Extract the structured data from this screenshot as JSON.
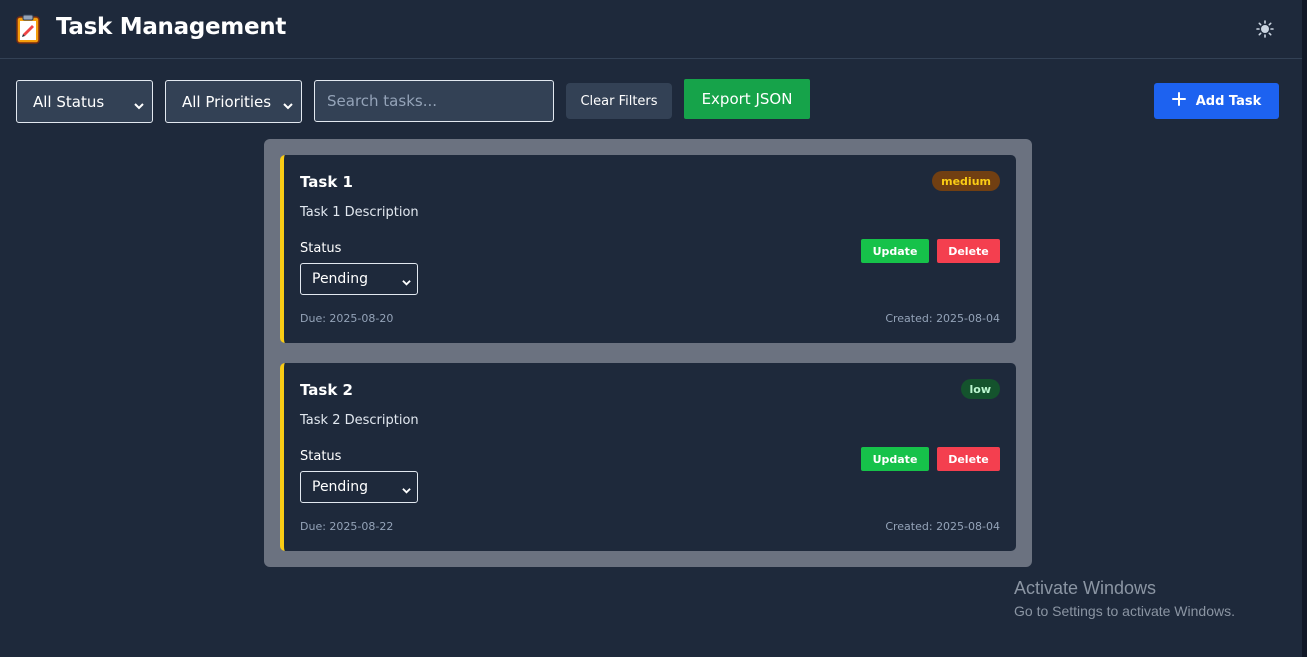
{
  "header": {
    "title": "Task Management",
    "logo_icon": "clipboard-icon",
    "theme_icon": "sun-icon"
  },
  "filters": {
    "status_selected": "All Status",
    "priority_selected": "All Priorities",
    "search_placeholder": "Search tasks...",
    "clear_label": "Clear Filters",
    "export_label": "Export JSON",
    "add_label": "Add Task"
  },
  "tasks": [
    {
      "title": "Task 1",
      "description": "Task 1 Description",
      "priority": "medium",
      "priority_bg": "#713f12",
      "priority_color": "#facc15",
      "status_label": "Status",
      "status_value": "Pending",
      "update_label": "Update",
      "delete_label": "Delete",
      "due": "Due: 2025-08-20",
      "created": "Created: 2025-08-04"
    },
    {
      "title": "Task 2",
      "description": "Task 2 Description",
      "priority": "low",
      "priority_bg": "#14532d",
      "priority_color": "#bbf7d0",
      "status_label": "Status",
      "status_value": "Pending",
      "update_label": "Update",
      "delete_label": "Delete",
      "due": "Due: 2025-08-22",
      "created": "Created: 2025-08-04"
    }
  ],
  "watermark": {
    "title": "Activate Windows",
    "subtitle": "Go to Settings to activate Windows."
  },
  "colors": {
    "background": "#1e293b",
    "accent_blue": "#1d62f0",
    "export_green": "#16a34a",
    "card_border": "#facc15"
  }
}
